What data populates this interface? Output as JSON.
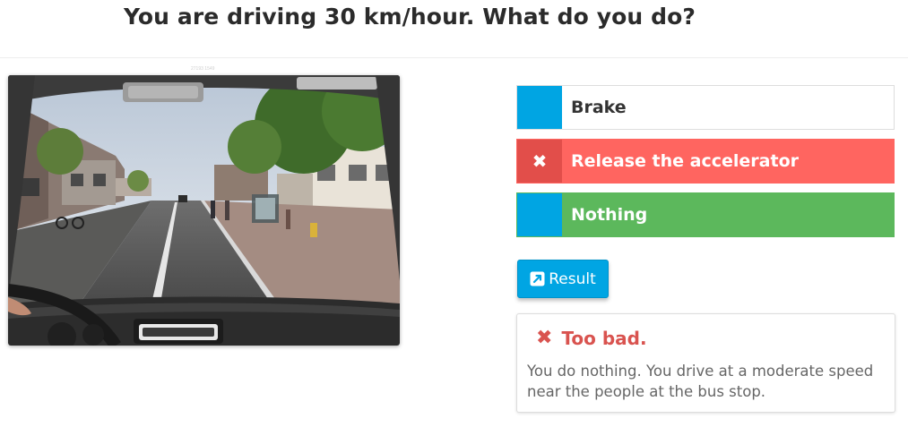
{
  "question": {
    "title": "You are driving 30 km/hour. What do you do?"
  },
  "image": {
    "caption": "27193 1549"
  },
  "answers": [
    {
      "label": "Brake",
      "state": "unselected"
    },
    {
      "label": "Release the accelerator",
      "state": "wrong-selection",
      "mark": "✖"
    },
    {
      "label": "Nothing",
      "state": "correct"
    }
  ],
  "result_button": {
    "label": "Result",
    "icon": "external-link-icon"
  },
  "feedback": {
    "mark": "✖",
    "title": "Too bad.",
    "text": "You do nothing. You drive at a moderate speed near the people at the bus stop."
  },
  "colors": {
    "accent_blue": "#00a5e3",
    "wrong_red": "#ff6560",
    "wrong_red_dark": "#e24e4a",
    "correct_green": "#5cb85c",
    "feedback_red": "#d9534f"
  }
}
